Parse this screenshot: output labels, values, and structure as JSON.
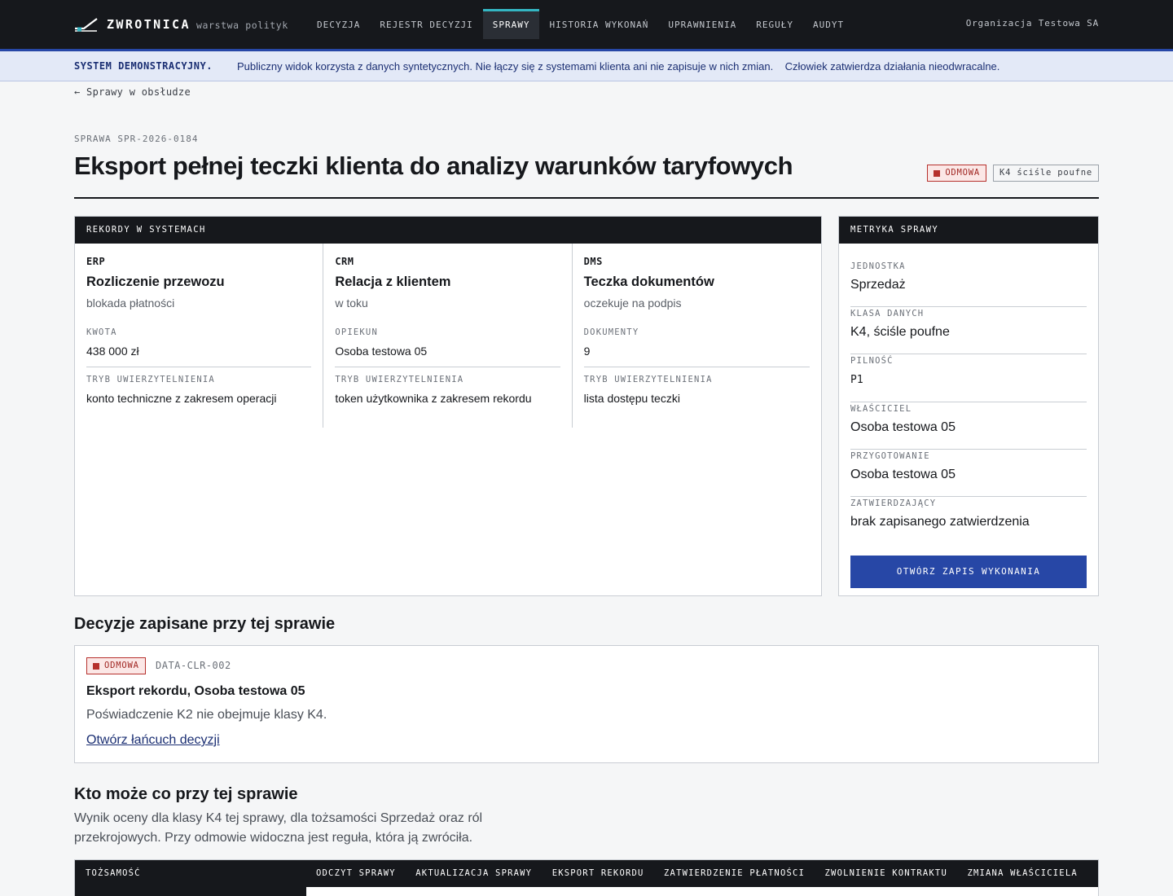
{
  "brand": {
    "name": "ZWROTNICA",
    "subtitle": "warstwa polityk"
  },
  "nav": {
    "items": [
      {
        "label": "DECYZJA",
        "active": false
      },
      {
        "label": "REJESTR DECYZJI",
        "active": false
      },
      {
        "label": "SPRAWY",
        "active": true
      },
      {
        "label": "HISTORIA WYKONAŃ",
        "active": false
      },
      {
        "label": "UPRAWNIENIA",
        "active": false
      },
      {
        "label": "REGUŁY",
        "active": false
      },
      {
        "label": "AUDYT",
        "active": false
      }
    ],
    "org": "Organizacja Testowa SA"
  },
  "banner": {
    "strong": "SYSTEM DEMONSTRACYJNY.",
    "text": "Publiczny widok korzysta z danych syntetycznych. Nie łączy się z systemami klienta ani nie zapisuje w nich zmian.    Człowiek zatwierdza działania nieodwracalne."
  },
  "back_link": "← Sprawy w obsłudze",
  "case": {
    "id": "SPRAWA SPR-2026-0184",
    "title": "Eksport pełnej teczki klienta do analizy warunków taryfowych",
    "status_badge": "ODMOWA",
    "class_badge": "K4 ściśle poufne"
  },
  "records": {
    "header": "REKORDY W SYSTEMACH",
    "items": [
      {
        "system": "ERP",
        "name": "Rozliczenie przewozu",
        "status": "blokada płatności",
        "field_label": "KWOTA",
        "field_value": "438 000 zł",
        "auth_label": "TRYB UWIERZYTELNIENIA",
        "auth_value": "konto techniczne z zakresem operacji"
      },
      {
        "system": "CRM",
        "name": "Relacja z klientem",
        "status": "w toku",
        "field_label": "OPIEKUN",
        "field_value": "Osoba testowa 05",
        "auth_label": "TRYB UWIERZYTELNIENIA",
        "auth_value": "token użytkownika z zakresem rekordu"
      },
      {
        "system": "DMS",
        "name": "Teczka dokumentów",
        "status": "oczekuje na podpis",
        "field_label": "DOKUMENTY",
        "field_value": "9",
        "auth_label": "TRYB UWIERZYTELNIENIA",
        "auth_value": "lista dostępu teczki"
      }
    ]
  },
  "metrics": {
    "header": "METRYKA SPRAWY",
    "rows": [
      {
        "label": "JEDNOSTKA",
        "value": "Sprzedaż"
      },
      {
        "label": "KLASA DANYCH",
        "value": "K4, ściśle poufne"
      },
      {
        "label": "PILNOŚĆ",
        "value": "P1"
      },
      {
        "label": "WŁAŚCICIEL",
        "value": "Osoba testowa 05"
      },
      {
        "label": "PRZYGOTOWANIE",
        "value": "Osoba testowa 05"
      },
      {
        "label": "ZATWIERDZAJĄCY",
        "value": "brak zapisanego zatwierdzenia"
      }
    ],
    "button": "OTWÓRZ ZAPIS WYKONANIA"
  },
  "decisions": {
    "heading": "Decyzje zapisane przy tej sprawie",
    "items": [
      {
        "badge": "ODMOWA",
        "code": "DATA-CLR-002",
        "name": "Eksport rekordu, Osoba testowa 05",
        "description": "Poświadczenie K2 nie obejmuje klasy K4.",
        "link": "Otwórz łańcuch decyzji"
      }
    ]
  },
  "permissions": {
    "heading": "Kto może co przy tej sprawie",
    "description": "Wynik oceny dla klasy K4 tej sprawy, dla tożsamości Sprzedaż oraz ról przekrojowych. Przy odmowie widoczna jest reguła, która ją zwróciła.",
    "columns": [
      "TOŻSAMOŚĆ",
      "ODCZYT SPRAWY",
      "AKTUALIZACJA SPRAWY",
      "EKSPORT REKORDU",
      "ZATWIERDZENIE PŁATNOŚCI",
      "ZWOLNIENIE KONTRAKTU",
      "ZMIANA WŁAŚCICIELA"
    ]
  },
  "colors": {
    "topbar": "#16181c",
    "accent": "#34b6c3",
    "primary": "#2747a6",
    "deny": "#b6302c"
  }
}
